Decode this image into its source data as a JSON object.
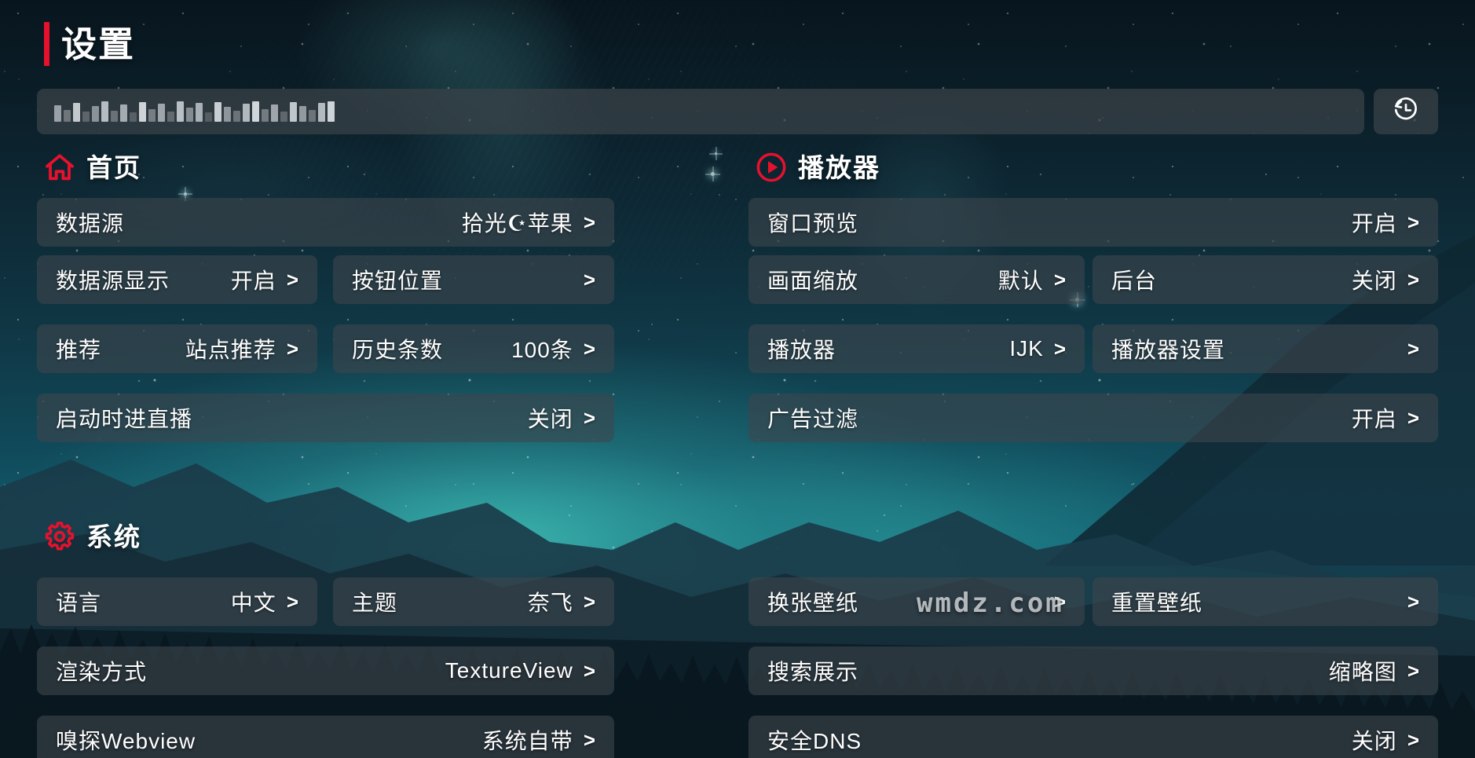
{
  "header": {
    "title": "设置",
    "accent_color": "#e8112d"
  },
  "search": {
    "value": "▓▓▓▓▓▓▓▓▓▓",
    "placeholder": "",
    "masked": true,
    "history_icon": "history-icon"
  },
  "sections": [
    {
      "id": "home",
      "title": "首页",
      "icon": "home-icon",
      "icon_color": "#e8112d",
      "rows": [
        [
          {
            "label": "数据源",
            "value": "拾光☪苹果",
            "chevron": ">",
            "width": "full",
            "name": "data-source"
          }
        ],
        [
          {
            "label": "数据源显示",
            "value": "开启",
            "chevron": ">",
            "width": "half",
            "name": "data-source-display"
          },
          {
            "label": "按钮位置",
            "value": "",
            "chevron": ">",
            "width": "half",
            "name": "button-position"
          }
        ],
        [
          {
            "label": "推荐",
            "value": "站点推荐",
            "chevron": ">",
            "width": "half",
            "name": "recommend"
          },
          {
            "label": "历史条数",
            "value": "100条",
            "chevron": ">",
            "width": "half",
            "name": "history-count"
          }
        ],
        [
          {
            "label": "启动时进直播",
            "value": "关闭",
            "chevron": ">",
            "width": "full",
            "name": "live-on-startup"
          }
        ]
      ]
    },
    {
      "id": "player",
      "title": "播放器",
      "icon": "play-circle-icon",
      "icon_color": "#e8112d",
      "rows": [
        [
          {
            "label": "窗口预览",
            "value": "开启",
            "chevron": ">",
            "width": "full",
            "name": "window-preview"
          }
        ],
        [
          {
            "label": "画面缩放",
            "value": "默认",
            "chevron": ">",
            "width": "half",
            "name": "screen-scale"
          },
          {
            "label": "后台",
            "value": "关闭",
            "chevron": ">",
            "width": "half",
            "name": "background-play"
          }
        ],
        [
          {
            "label": "播放器",
            "value": "IJK",
            "chevron": ">",
            "width": "half",
            "name": "player-core"
          },
          {
            "label": "播放器设置",
            "value": "",
            "chevron": ">",
            "width": "half",
            "name": "player-settings"
          }
        ],
        [
          {
            "label": "广告过滤",
            "value": "开启",
            "chevron": ">",
            "width": "full",
            "name": "ad-filter"
          }
        ]
      ]
    },
    {
      "id": "system",
      "title": "系统",
      "icon": "gear-icon",
      "icon_color": "#e8112d",
      "rows_left": [
        [
          {
            "label": "语言",
            "value": "中文",
            "chevron": ">",
            "width": "half",
            "name": "language"
          },
          {
            "label": "主题",
            "value": "奈飞",
            "chevron": ">",
            "width": "half",
            "name": "theme"
          }
        ],
        [
          {
            "label": "渲染方式",
            "value": "TextureView",
            "chevron": ">",
            "width": "full",
            "name": "render-mode"
          }
        ],
        [
          {
            "label": "嗅探Webview",
            "value": "系统自带",
            "chevron": ">",
            "width": "full",
            "name": "sniffer-webview"
          }
        ]
      ],
      "rows_right": [
        [
          {
            "label": "换张壁纸",
            "value": "",
            "chevron": ">",
            "width": "half",
            "name": "change-wallpaper"
          },
          {
            "label": "重置壁纸",
            "value": "",
            "chevron": ">",
            "width": "half",
            "name": "reset-wallpaper"
          }
        ],
        [
          {
            "label": "搜索展示",
            "value": "缩略图",
            "chevron": ">",
            "width": "full",
            "name": "search-display"
          }
        ],
        [
          {
            "label": "安全DNS",
            "value": "关闭",
            "chevron": ">",
            "width": "full",
            "name": "secure-dns"
          }
        ]
      ]
    }
  ],
  "watermark": {
    "text": "wmdz.com"
  },
  "colors": {
    "card_bg": "#3e464c",
    "text": "#ffffff",
    "accent": "#e8112d",
    "sky_teal": "#39b7ac"
  }
}
